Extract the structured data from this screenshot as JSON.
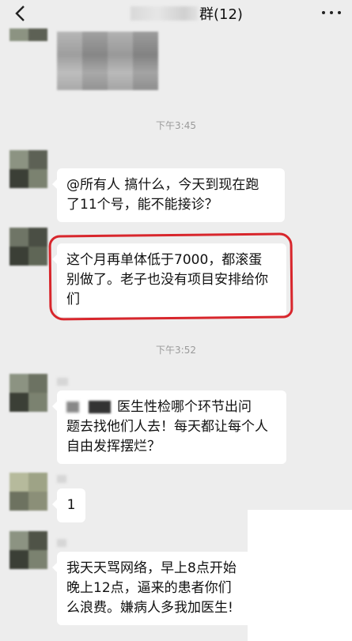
{
  "header": {
    "title": "群(12)",
    "back_icon": "chevron-left-icon",
    "more_icon": "more-dots-icon"
  },
  "messages": [
    {
      "type": "time",
      "text": "下午3:45"
    },
    {
      "type": "text",
      "text": "@所有人  搞什么，今天到现在跑了11个号，能不能接诊？"
    },
    {
      "type": "text",
      "text": "这个月再单体低于7000，都滚蛋别做了。老子也没有项目安排给你们",
      "highlighted": true,
      "highlight_color": "#d8262c"
    },
    {
      "type": "time",
      "text": "下午3:52"
    },
    {
      "type": "text",
      "text": "医生性检哪个环节出问题去找他们人去！每天都让每个人自由发挥摆烂？"
    },
    {
      "type": "text",
      "text": "1"
    },
    {
      "type": "text",
      "text": "我天天骂网络，早上8点开始到晚上12点，逼来的患者你们这么浪费。嫌病人多我加医生！"
    }
  ],
  "lines": {
    "m1_l1": "@所有人  搞什么，今天到现在跑",
    "m1_l2": "了11个号，能不能接诊？",
    "m2_l1": "这个月再单体低于7000，都滚蛋",
    "m2_l2": "别做了。老子也没有项目安排给你",
    "m2_l3": "们",
    "m3_l1": "医生性检哪个环节出问",
    "m3_l2": "题去找他们人去！每天都让每个人",
    "m3_l3": "自由发挥摆烂？",
    "m4_l1": "1",
    "m5_l1": "我天天骂网络，早上8点开始",
    "m5_l2": "晚上12点，逼来的患者你们",
    "m5_l3": "么浪费。嫌病人多我加医生!"
  },
  "colors": {
    "background": "#ededed",
    "bubble": "#ffffff",
    "highlight": "#d8262c",
    "time_text": "#9a9a9a"
  }
}
